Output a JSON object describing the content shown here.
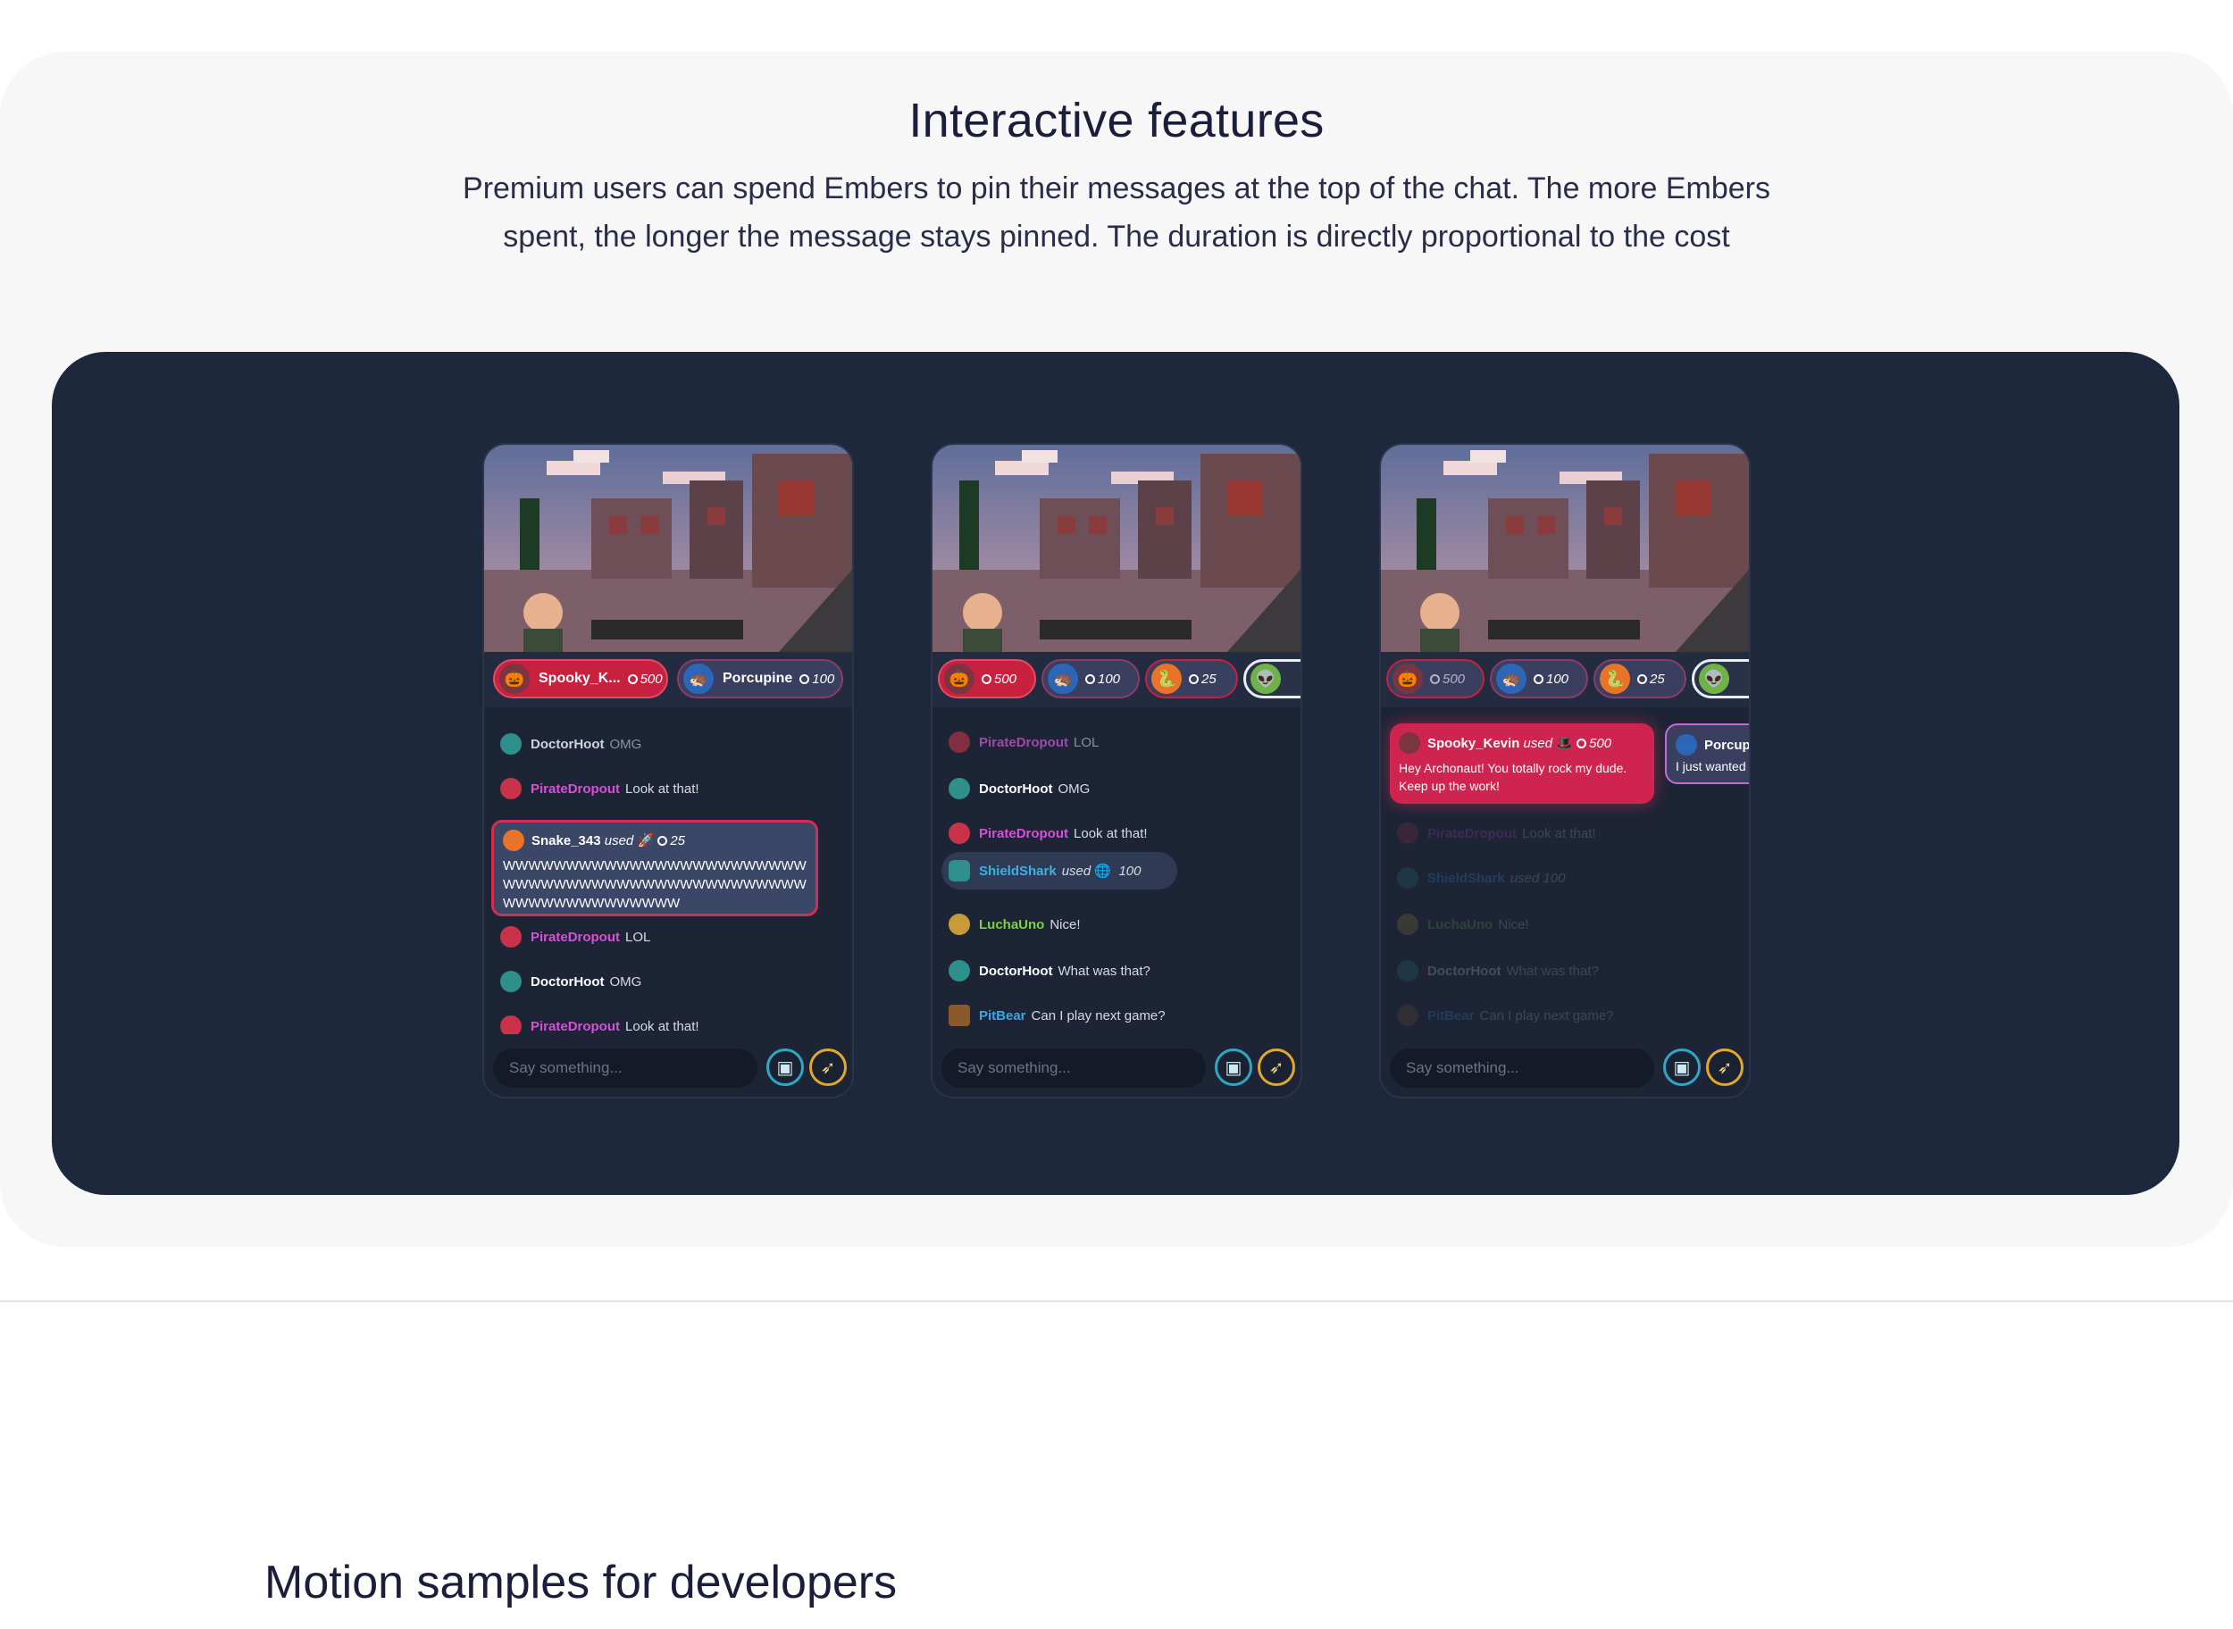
{
  "section": {
    "title": "Interactive features",
    "description": "Premium users can spend Embers to pin their messages at the top of the chat. The more Embers spent, the longer the message stays pinned. The duration is directly proportional to the cost"
  },
  "phones": [
    {
      "pills": [
        {
          "name": "Spooky_K...",
          "cost": "500"
        },
        {
          "name": "Porcupine",
          "cost": "100"
        }
      ],
      "messages": [
        {
          "user": "DoctorHoot",
          "text": "OMG"
        },
        {
          "user": "PirateDropout",
          "text": "Look at that!"
        },
        {
          "user": "PirateDropout",
          "text": "LOL"
        },
        {
          "user": "DoctorHoot",
          "text": "OMG"
        },
        {
          "user": "PirateDropout",
          "text": "Look at that!"
        }
      ],
      "highlight": {
        "user": "Snake_343",
        "used": "used",
        "cost": "25",
        "text": "WWWWWWWWWWWWWWWWWWWWWWWWWWWWWWWWWWWWWWWWWWWWWWWWWWWWWWWWWWWWWW"
      },
      "input_placeholder": "Say something..."
    },
    {
      "pills": [
        {
          "cost": "500"
        },
        {
          "cost": "100"
        },
        {
          "cost": "25"
        }
      ],
      "messages": [
        {
          "user": "PirateDropout",
          "text": "LOL"
        },
        {
          "user": "DoctorHoot",
          "text": "OMG"
        },
        {
          "user": "PirateDropout",
          "text": "Look at that!"
        },
        {
          "user": "ShieldShark",
          "text": "used",
          "cost": "100"
        },
        {
          "user": "LuchaUno",
          "text": "Nice!"
        },
        {
          "user": "DoctorHoot",
          "text": "What was that?"
        },
        {
          "user": "PitBear",
          "text": "Can I play next game?"
        }
      ],
      "input_placeholder": "Say something..."
    },
    {
      "pills": [
        {
          "cost": "500"
        },
        {
          "cost": "100"
        },
        {
          "cost": "25"
        }
      ],
      "pinned": [
        {
          "user": "Spooky_Kevin",
          "used": "used",
          "cost": "500",
          "text": "Hey Archonaut! You totally rock my dude. Keep up the work!"
        },
        {
          "user": "Porcup",
          "text": "I just wanted"
        }
      ],
      "messages": [
        {
          "user": "PirateDropout",
          "text": "Look at that!"
        },
        {
          "user": "ShieldShark",
          "text": "used",
          "cost": "100"
        },
        {
          "user": "LuchaUno",
          "text": "Nice!"
        },
        {
          "user": "DoctorHoot",
          "text": "What was that?"
        },
        {
          "user": "PitBear",
          "text": "Can I play next game?"
        }
      ],
      "input_placeholder": "Say something..."
    }
  ],
  "next_section": {
    "title": "Motion samples for developers"
  },
  "colors": {
    "stage": "#1e283d",
    "ember_red": "#c8203f",
    "pirate": "#d84fd8",
    "doctor": "#ffffff",
    "shield": "#37b4e6",
    "lucha": "#7bd23a",
    "pitbear": "#3aa8e6"
  }
}
